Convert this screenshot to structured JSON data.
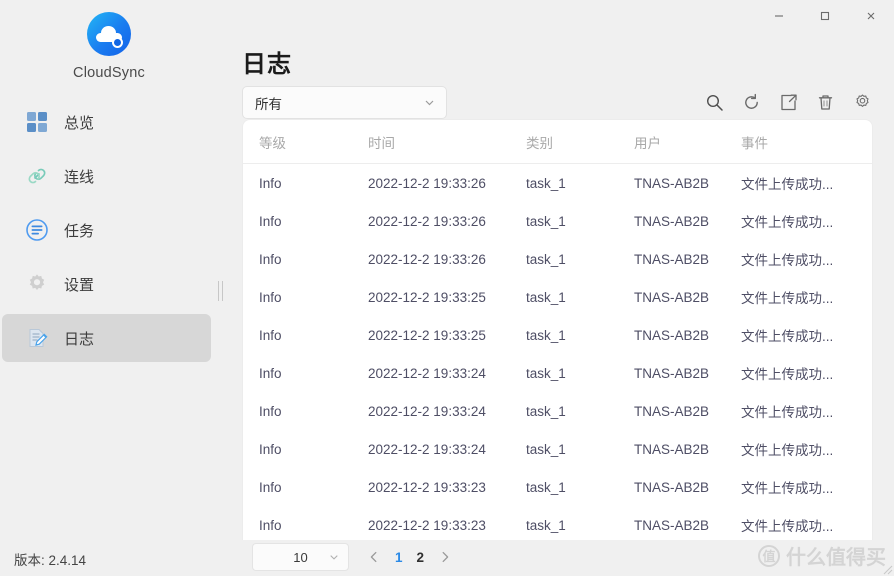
{
  "window": {
    "minimize_label": "—",
    "maximize_label": "□",
    "close_label": "✕"
  },
  "sidebar": {
    "brand_name": "CloudSync",
    "brand_icon": "cloud-logo-icon",
    "items": [
      {
        "label": "总览",
        "icon": "grid-icon",
        "active": false
      },
      {
        "label": "连线",
        "icon": "link-icon",
        "active": false
      },
      {
        "label": "任务",
        "icon": "task-icon",
        "active": false
      },
      {
        "label": "设置",
        "icon": "gear-icon",
        "active": false
      },
      {
        "label": "日志",
        "icon": "log-edit-icon",
        "active": true
      }
    ]
  },
  "main": {
    "title": "日志",
    "filter": {
      "value": "所有",
      "placeholder": "所有"
    },
    "toolbar": [
      {
        "name": "search-icon",
        "label": "搜索"
      },
      {
        "name": "refresh-icon",
        "label": "刷新"
      },
      {
        "name": "export-icon",
        "label": "导出"
      },
      {
        "name": "delete-icon",
        "label": "删除"
      },
      {
        "name": "settings-gear-icon",
        "label": "设置"
      }
    ],
    "table": {
      "columns": [
        "等级",
        "时间",
        "类别",
        "用户",
        "事件"
      ],
      "rows": [
        [
          "Info",
          "2022-12-2 19:33:26",
          "task_1",
          "TNAS-AB2B",
          "文件上传成功..."
        ],
        [
          "Info",
          "2022-12-2 19:33:26",
          "task_1",
          "TNAS-AB2B",
          "文件上传成功..."
        ],
        [
          "Info",
          "2022-12-2 19:33:26",
          "task_1",
          "TNAS-AB2B",
          "文件上传成功..."
        ],
        [
          "Info",
          "2022-12-2 19:33:25",
          "task_1",
          "TNAS-AB2B",
          "文件上传成功..."
        ],
        [
          "Info",
          "2022-12-2 19:33:25",
          "task_1",
          "TNAS-AB2B",
          "文件上传成功..."
        ],
        [
          "Info",
          "2022-12-2 19:33:24",
          "task_1",
          "TNAS-AB2B",
          "文件上传成功..."
        ],
        [
          "Info",
          "2022-12-2 19:33:24",
          "task_1",
          "TNAS-AB2B",
          "文件上传成功..."
        ],
        [
          "Info",
          "2022-12-2 19:33:24",
          "task_1",
          "TNAS-AB2B",
          "文件上传成功..."
        ],
        [
          "Info",
          "2022-12-2 19:33:23",
          "task_1",
          "TNAS-AB2B",
          "文件上传成功..."
        ],
        [
          "Info",
          "2022-12-2 19:33:23",
          "task_1",
          "TNAS-AB2B",
          "文件上传成功..."
        ]
      ]
    }
  },
  "footer": {
    "version": "版本: 2.4.14",
    "page_size": "10",
    "prev_label": "‹",
    "next_label": "›",
    "pages": [
      {
        "label": "1",
        "active": true
      },
      {
        "label": "2",
        "active": false
      }
    ]
  },
  "watermark": {
    "badge": "值",
    "text": "什么值得买"
  },
  "colors": {
    "accent": "#2b8ae6",
    "app_bg": "#f0f0f0",
    "card_bg": "#ffffff",
    "active_nav_bg": "#d7d7d7",
    "header_text": "#a9a9a9",
    "cell_text": "#4e4e65"
  }
}
